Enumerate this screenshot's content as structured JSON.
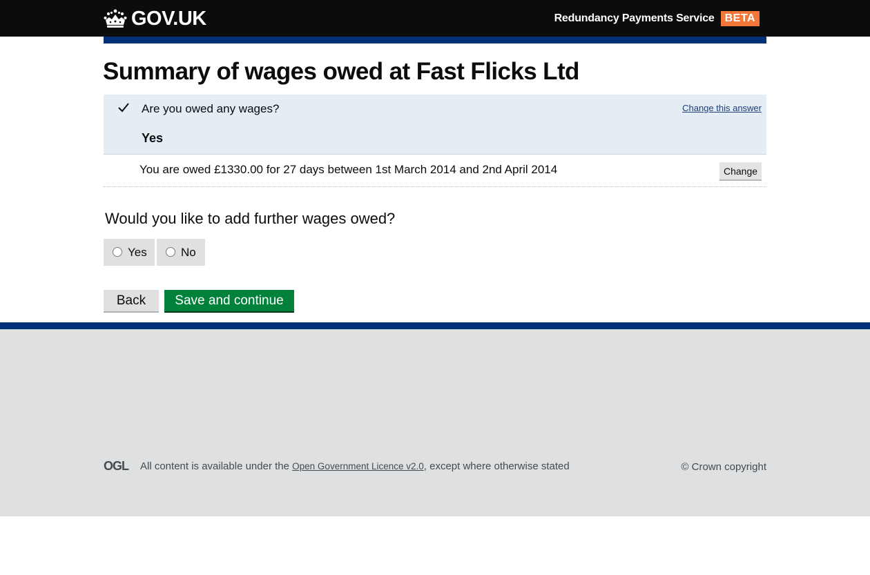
{
  "header": {
    "logo_text": "GOV.UK",
    "service_name": "Redundancy Payments Service",
    "phase_badge": "BETA"
  },
  "page": {
    "title": "Summary of wages owed at Fast Flicks Ltd"
  },
  "summary": {
    "question": "Are you owed any wages?",
    "change_link": "Change this answer",
    "answer": "Yes",
    "rows": [
      {
        "text": "You are owed £1330.00 for 27 days between 1st March 2014 and 2nd April 2014",
        "button": "Change"
      }
    ]
  },
  "further": {
    "question": "Would you like to add further wages owed?",
    "options": [
      "Yes",
      "No"
    ]
  },
  "actions": {
    "back": "Back",
    "save": "Save and continue"
  },
  "footer": {
    "ogl_label": "OGL",
    "licence_prefix": "All content is available under the",
    "licence_link": "Open Government Licence v2.0",
    "licence_suffix": ", except where otherwise stated",
    "copyright": "© Crown copyright"
  },
  "colors": {
    "header_bg": "#0b0c0c",
    "brand_blue": "#003078",
    "beta": "#f47738",
    "save_button": "#00823b",
    "summary_bg": "#e4ecf4",
    "footer_bg": "#dee0e2"
  }
}
